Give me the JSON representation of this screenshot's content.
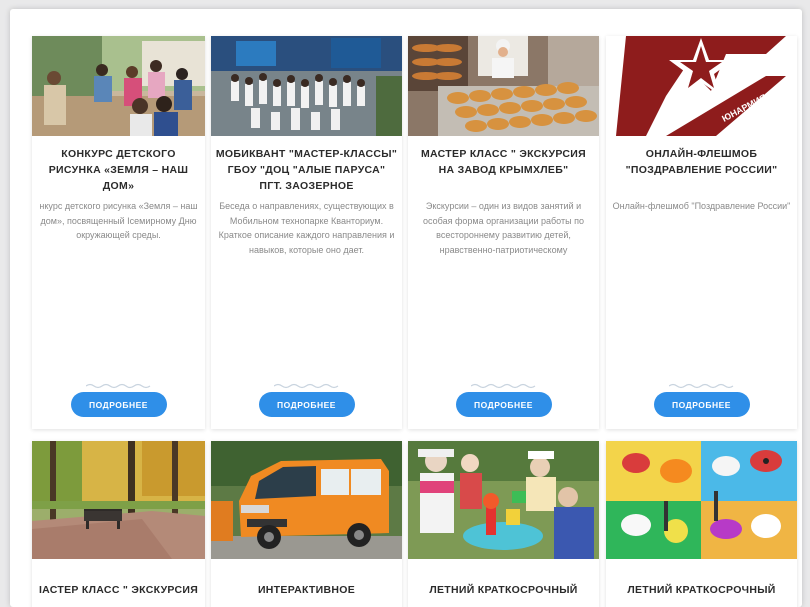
{
  "cards": [
    {
      "title": "КОНКУРС ДЕТСКОГО РИСУНКА «ЗЕМЛЯ – НАШ ДОМ»",
      "description": "нкурс детского рисунка «Земля – наш дом», посвященный Ісемирному Дню окружающей среды.",
      "button": "ПОДРОБНЕЕ"
    },
    {
      "title": "МОБИКВАНТ \"МАСТЕР-КЛАССЫ\" ГБОУ \"ДОЦ \"АЛЫЕ ПАРУСА\" ПГТ. ЗАОЗЕРНОЕ",
      "description": "Беседа о направлениях, существующих в Мобильном технопарке Кванториум. Краткое описание каждого направления и навыков, которые оно дает.",
      "button": "ПОДРОБНЕЕ"
    },
    {
      "title": "МАСТЕР КЛАСС \" ЭКСКУРСИЯ НА ЗАВОД КРЫМХЛЕБ\"",
      "description": "Экскурсии – один из видов занятий и особая форма организации работы по всестороннему развитию детей, нравственно-патриотическому",
      "button": "ПОДРОБНЕЕ"
    },
    {
      "title": "ОНЛАЙН-ФЛЕШМОБ \"ПОЗДРАВЛЕНИЕ РОССИИ\"",
      "description": "Онлайн-флешмоб \"Поздравление России\"",
      "button": "ПОДРОБНЕЕ",
      "logo_text": "ЮНАРМИЯ"
    },
    {
      "title": "ІАСТЕР КЛАСС \" ЭКСКУРСИЯ"
    },
    {
      "title": "ИНТЕРАКТИВНОЕ"
    },
    {
      "title": "ЛЕТНИЙ КРАТКОСРОЧНЫЙ"
    },
    {
      "title": "ЛЕТНИЙ КРАТКОСРОЧНЫЙ"
    }
  ],
  "colors": {
    "button": "#2f8fe8",
    "title": "#2b2b2b",
    "description": "#8a8a8a",
    "logo_red": "#8e1c1c"
  }
}
